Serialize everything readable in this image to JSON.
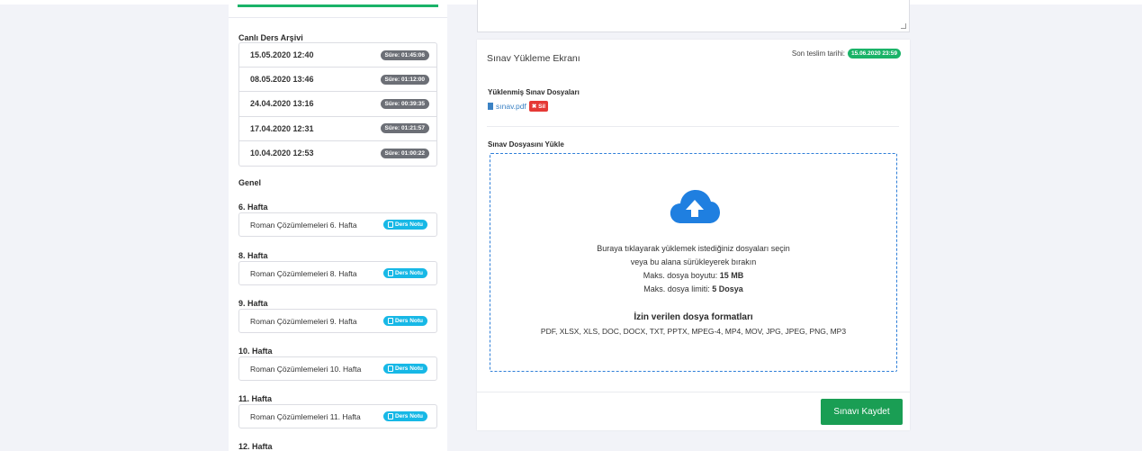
{
  "sidebar": {
    "archive_title": "Canlı Ders Arşivi",
    "archive": [
      {
        "date": "15.05.2020 12:40",
        "duration": "Süre: 01:45:06"
      },
      {
        "date": "08.05.2020 13:46",
        "duration": "Süre: 01:12:00"
      },
      {
        "date": "24.04.2020 13:16",
        "duration": "Süre: 00:39:35"
      },
      {
        "date": "17.04.2020 12:31",
        "duration": "Süre: 01:21:57"
      },
      {
        "date": "10.04.2020 12:53",
        "duration": "Süre: 01:00:22"
      }
    ],
    "general_title": "Genel",
    "weeks": [
      {
        "title": "6. Hafta",
        "label": "Roman Çözümlemeleri 6. Hafta",
        "badge": "Ders Notu"
      },
      {
        "title": "8. Hafta",
        "label": "Roman Çözümlemeleri 8. Hafta",
        "badge": "Ders Notu"
      },
      {
        "title": "9. Hafta",
        "label": "Roman Çözümlemeleri 9. Hafta",
        "badge": "Ders Notu"
      },
      {
        "title": "10. Hafta",
        "label": "Roman Çözümlemeleri 10. Hafta",
        "badge": "Ders Notu"
      },
      {
        "title": "11. Hafta",
        "label": "Roman Çözümlemeleri 11. Hafta",
        "badge": "Ders Notu"
      },
      {
        "title": "12. Hafta"
      }
    ]
  },
  "panel": {
    "title": "Sınav Yükleme Ekranı",
    "deadline_label": "Son teslim tarihi:",
    "deadline_value": "15.06.2020 23:59",
    "uploaded_title": "Yüklenmiş Sınav Dosyaları",
    "file_name": "sınav.pdf",
    "delete_label": "✖ Sil",
    "upload_title": "Sınav Dosyasını Yükle",
    "dropzone": {
      "line1": "Buraya tıklayarak yüklemek istediğiniz dosyaları seçin",
      "line2": "veya bu alana sürükleyerek bırakın",
      "max_size_label": "Maks. dosya boyutu:",
      "max_size_value": "15 MB",
      "max_count_label": "Maks. dosya limiti:",
      "max_count_value": "5 Dosya",
      "formats_title": "İzin verilen dosya formatları",
      "formats": "PDF, XLSX, XLS, DOC, DOCX, TXT, PPTX, MPEG-4, MP4, MOV, JPG, JPEG, PNG, MP3"
    },
    "save_label": "Sınavı Kaydet"
  },
  "icons": {
    "cloud": "cloud-upload-icon",
    "file": "file-icon",
    "note": "document-icon"
  },
  "colors": {
    "accent_green": "#1ab368",
    "save_green": "#1a9e54",
    "info_blue": "#17b8e6",
    "link_blue": "#3b82c4",
    "danger": "#e53935",
    "badge_gray": "#6c6f76"
  }
}
